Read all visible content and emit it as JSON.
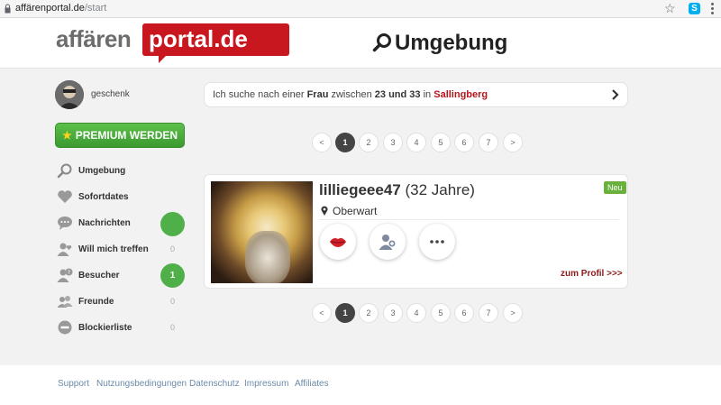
{
  "browser": {
    "url_host": "affärenportal.de",
    "url_path": "/start",
    "skype_icon": "S"
  },
  "header": {
    "logo_part1": "affären",
    "logo_part2": "portal.de",
    "title": "Umgebung"
  },
  "sidebar": {
    "username": "geschenk",
    "premium_label": "PREMIUM WERDEN",
    "items": [
      {
        "label": "Umgebung",
        "icon": "search-icon",
        "count": ""
      },
      {
        "label": "Sofortdates",
        "icon": "heart-icon",
        "count": ""
      },
      {
        "label": "Nachrichten",
        "icon": "chat-icon",
        "count": ""
      },
      {
        "label": "Will mich treffen",
        "icon": "user-heart-icon",
        "count": "0"
      },
      {
        "label": "Besucher",
        "icon": "user-question-icon",
        "count": "1"
      },
      {
        "label": "Freunde",
        "icon": "users-icon",
        "count": "0"
      },
      {
        "label": "Blockierliste",
        "icon": "block-icon",
        "count": "0"
      }
    ]
  },
  "search": {
    "prefix": "Ich suche nach einer",
    "gender": "Frau",
    "between": "zwischen",
    "age_range": "23 und 33",
    "in": "in",
    "location": "Sallingberg"
  },
  "pagination": {
    "prev": "<",
    "next": ">",
    "pages": [
      "1",
      "2",
      "3",
      "4",
      "5",
      "6",
      "7"
    ],
    "current": "1"
  },
  "profile": {
    "name": "lilliegeee47",
    "age": "(32 Jahre)",
    "location": "Oberwart",
    "new_badge": "Neu",
    "link": "zum Profil >>>"
  },
  "footer": {
    "links": [
      "Support",
      "Nutzungsbedingungen",
      "Datenschutz",
      "Impressum",
      "Affiliates"
    ]
  },
  "colors": {
    "brand_red": "#c8171e",
    "accent_green": "#4fb04a",
    "link_dark_red": "#8b1a1a"
  }
}
